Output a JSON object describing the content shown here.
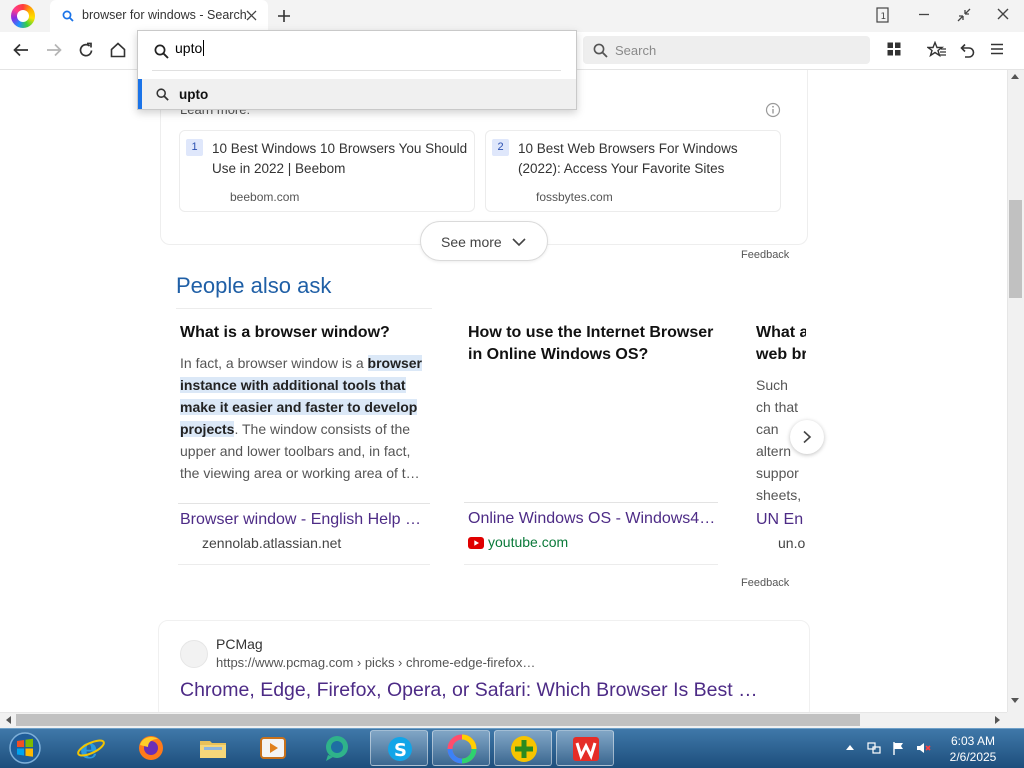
{
  "browser": {
    "tab_title": "browser for windows - Search",
    "search_placeholder": "Search",
    "address_value": "upto",
    "suggestion": "upto",
    "accent": "#1a73e8"
  },
  "top_results": {
    "learn_more": "Learn more:",
    "cards": [
      {
        "num": "1",
        "title": "10 Best Windows 10 Browsers You Should Use in 2022 | Beebom",
        "source": "beebom.com"
      },
      {
        "num": "2",
        "title": "10 Best Web Browsers For Windows (2022): Access Your Favorite Sites",
        "source": "fossbytes.com"
      }
    ],
    "see_more": "See more",
    "feedback": "Feedback"
  },
  "paa": {
    "title": "People also ask",
    "items": [
      {
        "question": "What is a browser window?",
        "answer_pre": "In fact, a browser window is a ",
        "answer_hl": "browser instance with additional tools that make it easier and faster to develop projects",
        "answer_post": ". The window consists of the upper and lower toolbars and, in fact, the viewing area or working area of t…",
        "link": "Browser window - English Help …",
        "source": "zennolab.atlassian.net"
      },
      {
        "question": "How to use the Internet Browser in Online Windows OS?",
        "link": "Online Windows OS - Windows4…",
        "source": "youtube.com"
      },
      {
        "question": "What a web br",
        "answer": "Such ch that can altern suppor sheets,",
        "link": "UN En",
        "source": "un.o"
      }
    ],
    "feedback": "Feedback"
  },
  "pcmag": {
    "name": "PCMag",
    "url": "https://www.pcmag.com › picks › chrome-edge-firefox…",
    "title": "Chrome, Edge, Firefox, Opera, or Safari: Which Browser Is Best …"
  },
  "taskbar": {
    "time": "6:03 AM",
    "date": "2/6/2025"
  }
}
